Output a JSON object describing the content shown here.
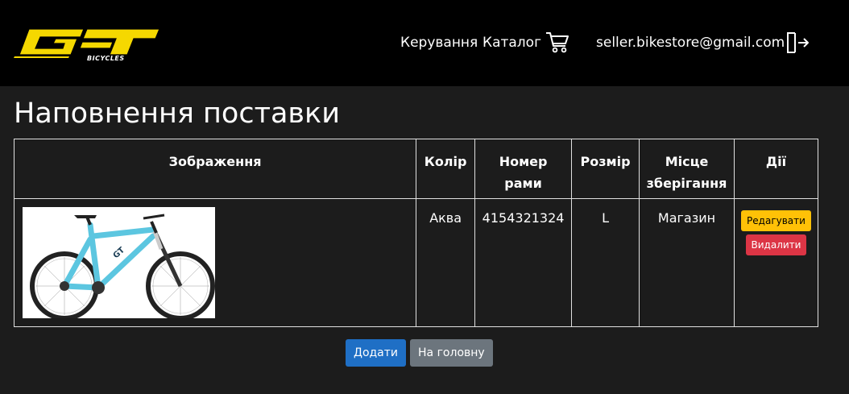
{
  "header": {
    "logo_text": "GT BICYCLES",
    "nav": {
      "management": "Керування",
      "catalog": "Каталог",
      "email": "seller.bikestore@gmail.com"
    }
  },
  "page": {
    "title": "Наповнення поставки"
  },
  "table": {
    "headers": {
      "image": "Зображення",
      "color": "Колір",
      "frame_number": "Номер рами",
      "size": "Розмір",
      "location": "Місце зберігання",
      "actions": "Дії"
    },
    "rows": [
      {
        "color": "Аква",
        "frame_number": "4154321324",
        "size": "L",
        "location": "Магазин",
        "edit_label": "Редагувати",
        "delete_label": "Видалити"
      }
    ]
  },
  "buttons": {
    "add": "Додати",
    "home": "На головну"
  },
  "colors": {
    "background": "#1c1c1c",
    "navbar": "#000000",
    "logo_yellow": "#f5d800",
    "bike_frame": "#5cc6e0"
  }
}
